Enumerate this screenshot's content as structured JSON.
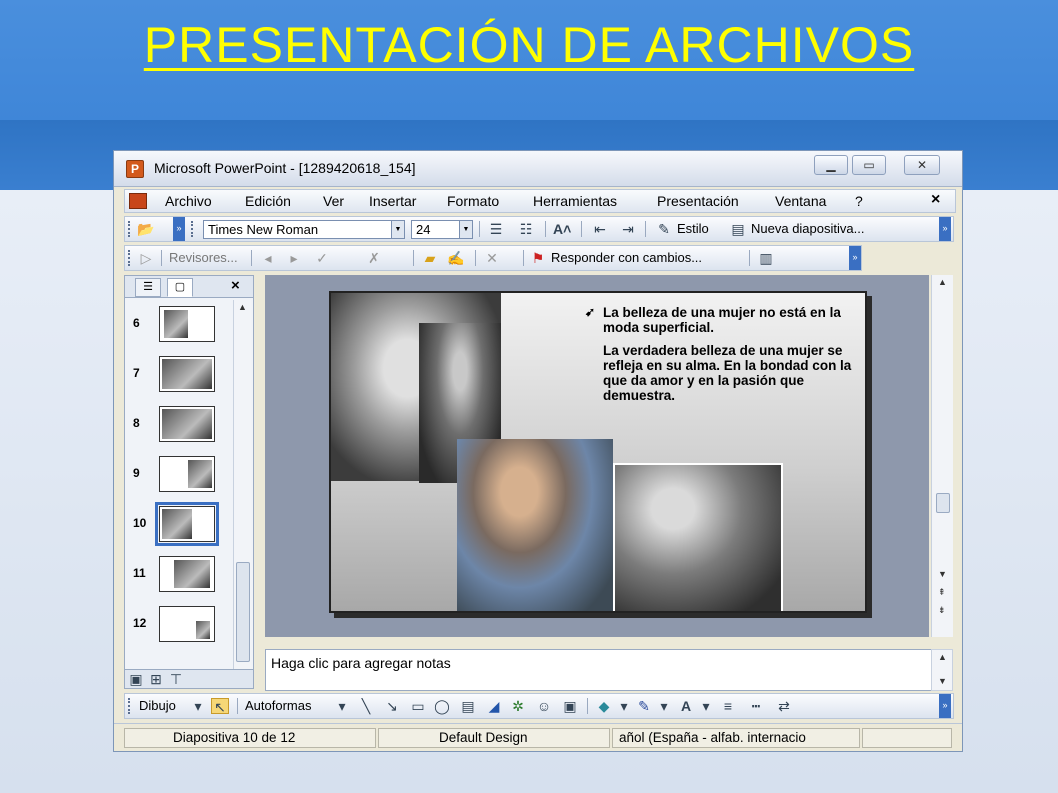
{
  "slide_title": "PRESENTACIÓN  DE ARCHIVOS",
  "window": {
    "title": "Microsoft PowerPoint - [1289420618_154]"
  },
  "menu": [
    "Archivo",
    "Edición",
    "Ver",
    "Insertar",
    "Formato",
    "Herramientas",
    "Presentación",
    "Ventana",
    "?"
  ],
  "format_toolbar": {
    "font": "Times New Roman",
    "size": "24",
    "style_label": "Estilo",
    "new_slide_label": "Nueva diapositiva..."
  },
  "review_toolbar": {
    "reviewers_label": "Revisores...",
    "reply_label": "Responder con cambios..."
  },
  "thumbnails": [
    {
      "num": "6"
    },
    {
      "num": "7"
    },
    {
      "num": "8"
    },
    {
      "num": "9"
    },
    {
      "num": "10",
      "selected": true
    },
    {
      "num": "11"
    },
    {
      "num": "12"
    }
  ],
  "slide": {
    "paragraph_1": "La belleza de una mujer no está en la moda superficial.",
    "paragraph_2": "La verdadera belleza de una mujer se refleja en su alma. En la bondad con la que da amor y en la pasión que demuestra."
  },
  "notes_placeholder": "Haga clic para agregar notas",
  "drawing_toolbar": {
    "draw_label": "Dibujo",
    "autoshapes_label": "Autoformas"
  },
  "status_bar": {
    "slide_position": "Diapositiva 10 de 12",
    "design": "Default Design",
    "language": "añol (España - alfab. internacio"
  },
  "colors": {
    "title_yellow": "#ffff00",
    "header_blue": "#4a8fdd",
    "selection_blue": "#3a6fc2"
  }
}
